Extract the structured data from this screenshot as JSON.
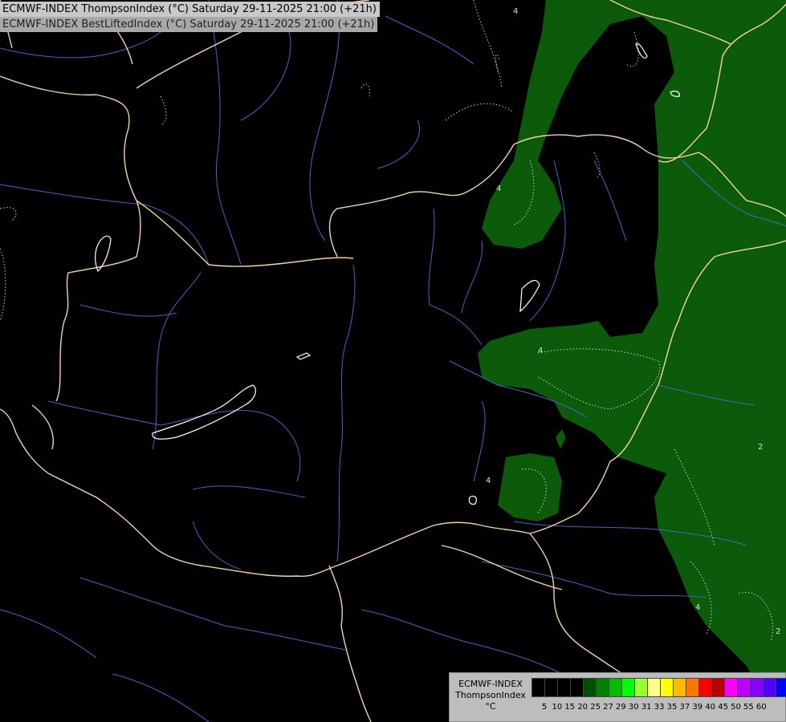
{
  "header": {
    "line1": "ECMWF-INDEX ThompsonIndex (°C) Saturday 29-11-2025 21:00 (+21h)",
    "line2": "ECMWF-INDEX BestLiftedIndex (°C) Saturday 29-11-2025 21:00 (+21h)"
  },
  "map": {
    "background_color": "#000000",
    "border_color": "#f5d3a6",
    "river_color": "#4b63c8",
    "lake_outline_color": "#ffffff",
    "contour_labels": [
      "4",
      "4",
      "4",
      "4",
      "2",
      "4",
      "2"
    ]
  },
  "legend": {
    "title_line1": "ECMWF-INDEX",
    "title_line2": "ThompsonIndex",
    "unit": "°C",
    "colors": [
      "#000000",
      "#000000",
      "#000000",
      "#000000",
      "#005000",
      "#008000",
      "#00bb00",
      "#00ff00",
      "#99ff33",
      "#ffff88",
      "#ffff00",
      "#ffbb00",
      "#ff7700",
      "#ff0000",
      "#bb0000",
      "#ff00ff",
      "#bb00ff",
      "#8800ff",
      "#5500ff",
      "#0000ff"
    ],
    "ticks": [
      "5",
      "10",
      "15",
      "20",
      "25",
      "27",
      "29",
      "30",
      "31",
      "33",
      "35",
      "37",
      "39",
      "40",
      "45",
      "50",
      "55",
      "60"
    ]
  }
}
